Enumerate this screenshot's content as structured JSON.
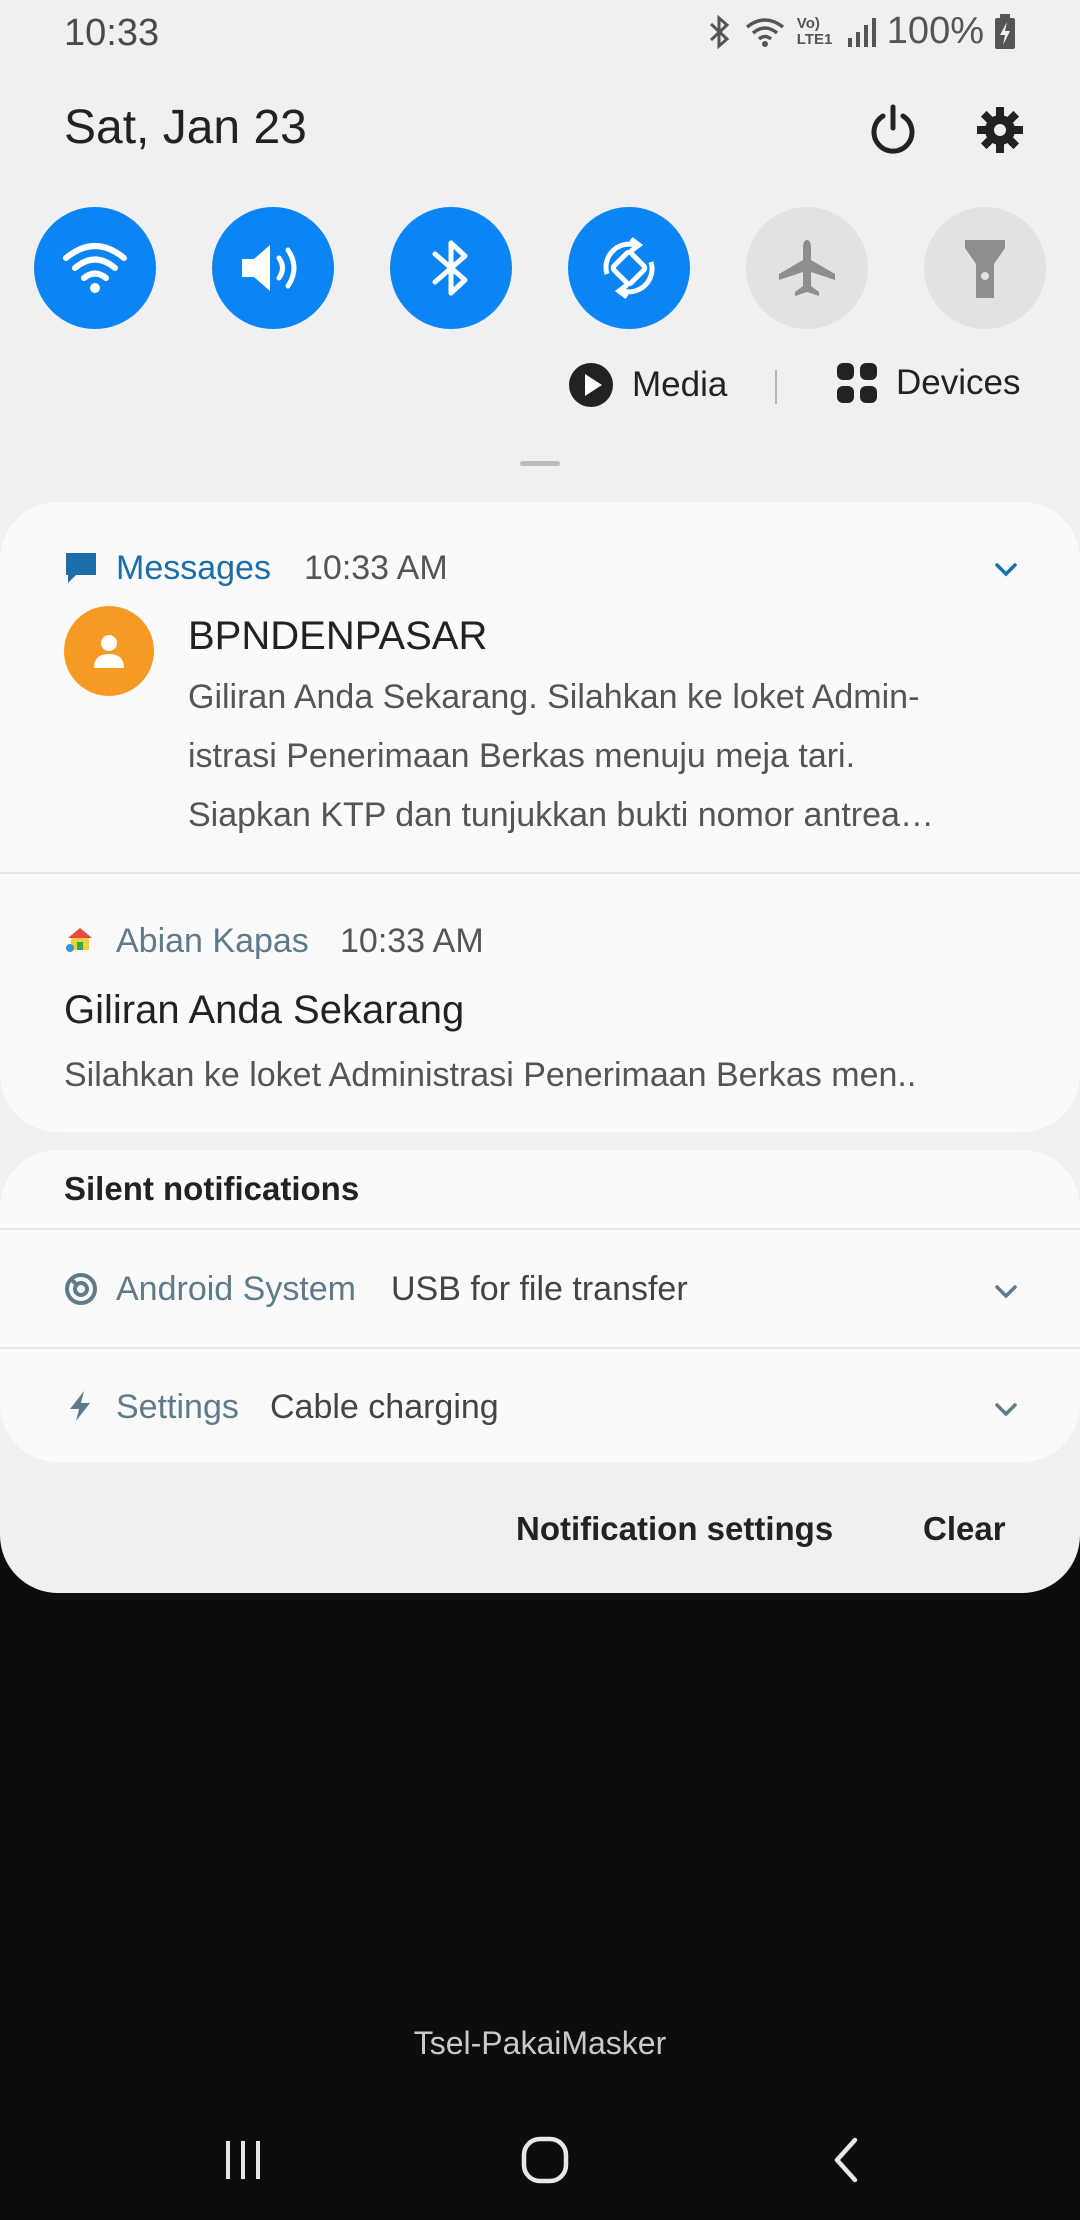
{
  "status_bar": {
    "time": "10:33",
    "network_label": "Vo) LTE1",
    "battery": "100%"
  },
  "header": {
    "date": "Sat, Jan 23",
    "power_icon": "power-icon",
    "settings_icon": "gear-icon"
  },
  "quick_settings": [
    {
      "name": "wifi",
      "state": "on"
    },
    {
      "name": "sound",
      "state": "on"
    },
    {
      "name": "bluetooth",
      "state": "on"
    },
    {
      "name": "auto-rotate",
      "state": "on"
    },
    {
      "name": "airplane-mode",
      "state": "off"
    },
    {
      "name": "flashlight",
      "state": "off"
    }
  ],
  "media_row": {
    "media_label": "Media",
    "devices_label": "Devices"
  },
  "notifications": [
    {
      "app": "Messages",
      "time": "10:33 AM",
      "title": "BPNDENPASAR",
      "body_lines": [
        "Giliran Anda Sekarang. Silahkan ke loket Admin-",
        "istrasi Penerimaan Berkas menuju meja tari.",
        "Siapkan KTP dan tunjukkan bukti nomor antrea…"
      ]
    },
    {
      "app": "Abian Kapas",
      "time": "10:33 AM",
      "title": "Giliran Anda Sekarang",
      "body": "Silahkan ke loket Administrasi Penerimaan Berkas men.."
    }
  ],
  "silent": {
    "header": "Silent notifications",
    "items": [
      {
        "app": "Android System",
        "text": "USB for file transfer"
      },
      {
        "app": "Settings",
        "text": "Cable charging"
      }
    ]
  },
  "footer": {
    "notification_settings": "Notification settings",
    "clear": "Clear"
  },
  "carrier": "Tsel-PakaiMasker",
  "colors": {
    "accent": "#0b84f4",
    "app_name": "#1c6ea8",
    "avatar": "#f79a24"
  }
}
